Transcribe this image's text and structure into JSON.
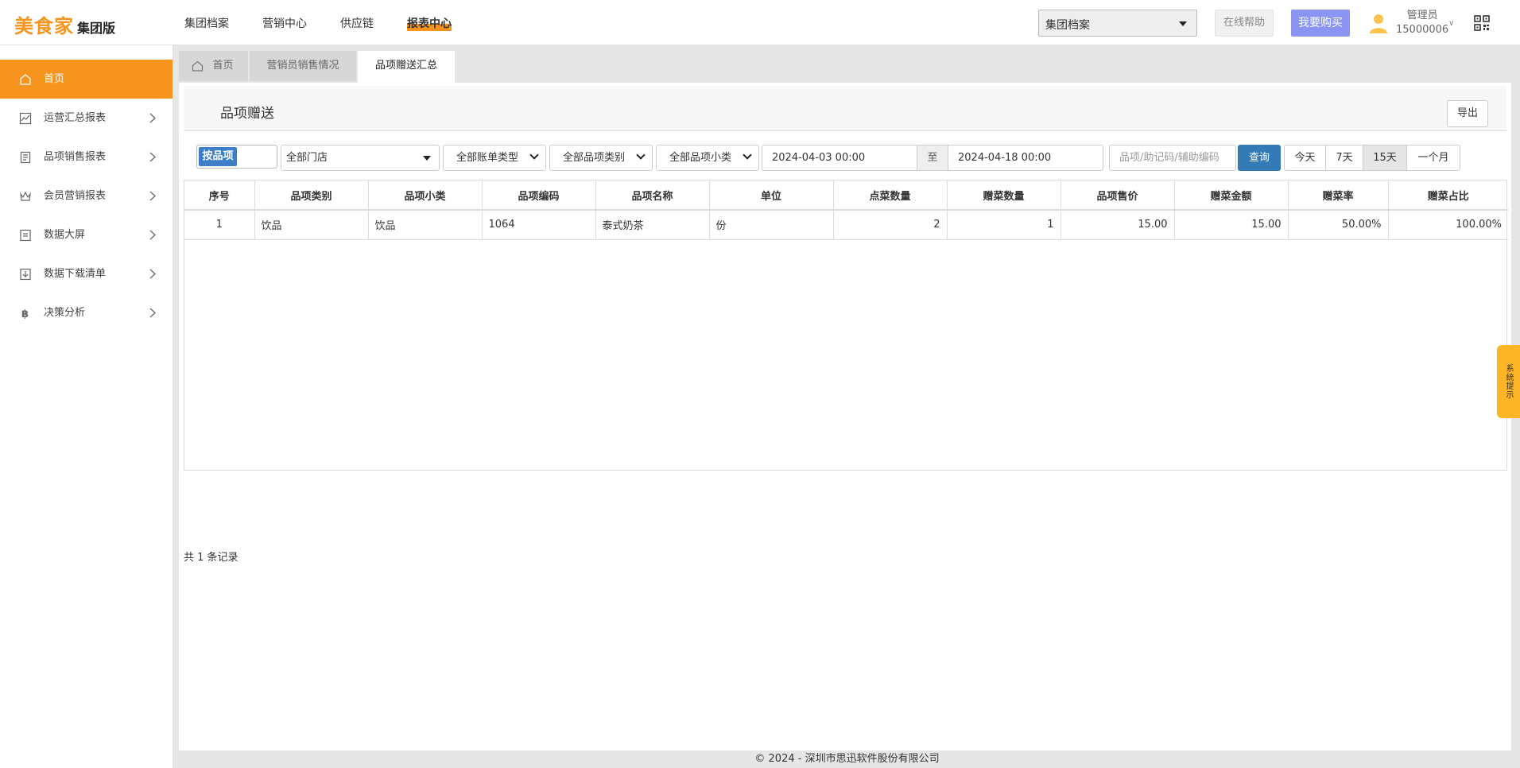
{
  "header": {
    "logo_main": "美食家",
    "logo_sub": "集团版",
    "nav": [
      "集团档案",
      "营销中心",
      "供应链",
      "报表中心"
    ],
    "archive_select": "集团档案",
    "help_label": "在线帮助",
    "buy_label": "我要购买",
    "user_name": "管理员",
    "user_id": "15000006"
  },
  "sidebar": {
    "items": [
      {
        "label": "首页"
      },
      {
        "label": "运营汇总报表"
      },
      {
        "label": "品项销售报表"
      },
      {
        "label": "会员营销报表"
      },
      {
        "label": "数据大屏"
      },
      {
        "label": "数据下载清单"
      },
      {
        "label": "决策分析"
      }
    ]
  },
  "tabs": [
    "首页",
    "营销员销售情况",
    "品项赠送汇总"
  ],
  "page": {
    "title": "品项赠送",
    "export_label": "导出"
  },
  "filters": {
    "toggle_label": "按品项",
    "store": "全部门店",
    "bill_type": "全部账单类型",
    "category": "全部品项类别",
    "subcategory": "全部品项小类",
    "date_from": "2024-04-03 00:00",
    "date_sep": "至",
    "date_to": "2024-04-18 00:00",
    "keyword_placeholder": "品项/助记码/辅助编码",
    "query_label": "查询",
    "ranges": [
      "今天",
      "7天",
      "15天",
      "一个月"
    ]
  },
  "table": {
    "headers": [
      "序号",
      "品项类别",
      "品项小类",
      "品项编码",
      "品项名称",
      "单位",
      "点菜数量",
      "赠菜数量",
      "品项售价",
      "赠菜金额",
      "赠菜率",
      "赠菜占比"
    ],
    "rows": [
      [
        "1",
        "饮品",
        "饮品",
        "1064",
        "泰式奶茶",
        "份",
        "2",
        "1",
        "15.00",
        "15.00",
        "50.00%",
        "100.00%"
      ]
    ]
  },
  "record_count": "共 1 条记录",
  "footer": "© 2024 - 深圳市思迅软件股份有限公司",
  "system_tip": "系统提示",
  "colors": {
    "brand": "#f7941d",
    "primary": "#337ab7",
    "buy": "#8a94f2"
  }
}
